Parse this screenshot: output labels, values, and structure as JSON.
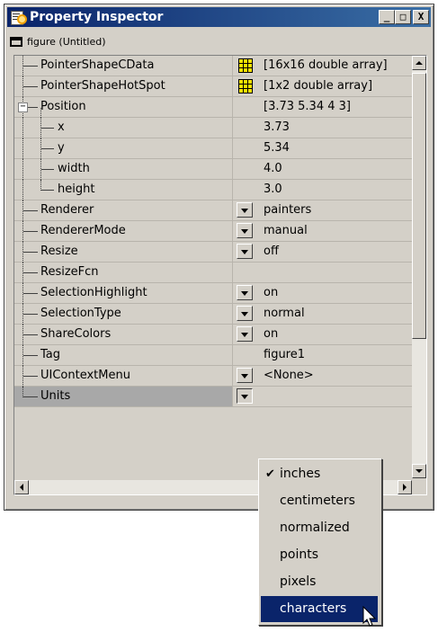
{
  "window": {
    "title": "Property Inspector",
    "minimize": "_",
    "maximize": "□",
    "close": "X",
    "object_label": "figure (Untitled)"
  },
  "rows": [
    {
      "name": "PointerShapeCData",
      "value": "[16x16  double array]",
      "control": "grid-icon"
    },
    {
      "name": "PointerShapeHotSpot",
      "value": "[1x2  double array]",
      "control": "grid-icon"
    },
    {
      "name": "Position",
      "value": "[3.73 5.34 4 3]",
      "expander": "−"
    },
    {
      "name": "x",
      "value": "3.73"
    },
    {
      "name": "y",
      "value": "5.34"
    },
    {
      "name": "width",
      "value": "4.0"
    },
    {
      "name": "height",
      "value": "3.0"
    },
    {
      "name": "Renderer",
      "value": "painters",
      "control": "dropdown"
    },
    {
      "name": "RendererMode",
      "value": "manual",
      "control": "dropdown"
    },
    {
      "name": "Resize",
      "value": "off",
      "control": "dropdown"
    },
    {
      "name": "ResizeFcn",
      "value": ""
    },
    {
      "name": "SelectionHighlight",
      "value": "on",
      "control": "dropdown"
    },
    {
      "name": "SelectionType",
      "value": "normal",
      "control": "dropdown"
    },
    {
      "name": "ShareColors",
      "value": "on",
      "control": "dropdown"
    },
    {
      "name": "Tag",
      "value": "figure1"
    },
    {
      "name": "UIContextMenu",
      "value": "<None>",
      "control": "dropdown"
    },
    {
      "name": "Units",
      "value": "",
      "control": "dropdown"
    }
  ],
  "units_menu": {
    "options": [
      "inches",
      "centimeters",
      "normalized",
      "points",
      "pixels",
      "characters"
    ],
    "checked": "inches",
    "highlighted": "characters",
    "check_glyph": "✔"
  },
  "colors": {
    "title_gradient_start": "#0a246a",
    "title_gradient_end": "#3a6ea5",
    "selection": "#0a246a",
    "face": "#d4d0c8"
  }
}
